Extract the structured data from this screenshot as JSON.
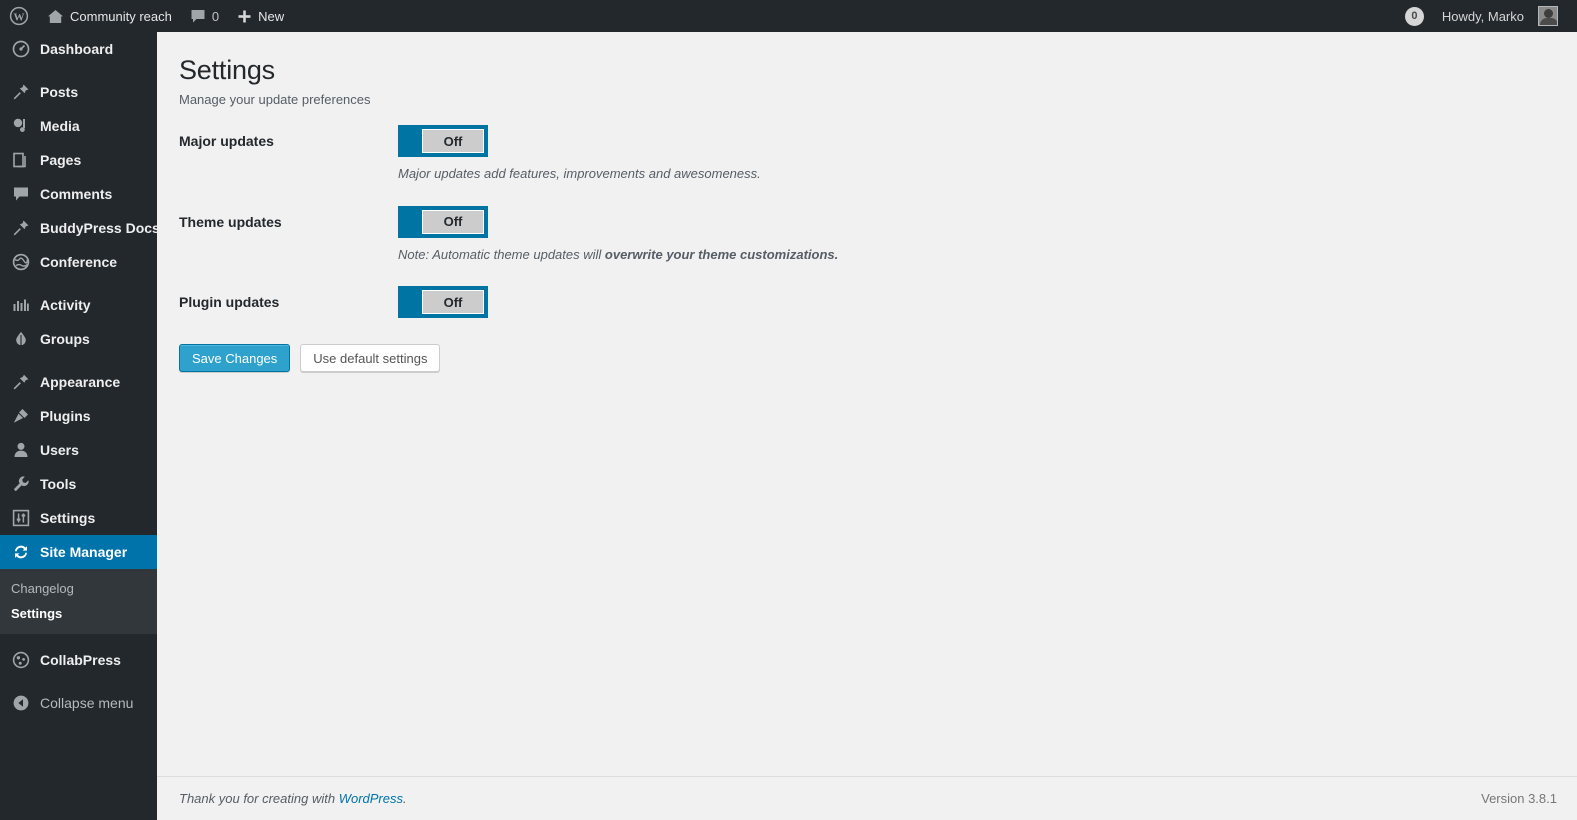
{
  "adminbar": {
    "wp_logo_icon": "wordpress-logo-icon",
    "site_name": "Community reach",
    "site_icon": "home-icon",
    "comments_icon": "comment-bubble-icon",
    "comments_count": "0",
    "new_icon": "plus-icon",
    "new_label": "New",
    "updates_count": "0",
    "howdy": "Howdy, Marko",
    "avatar": "user-avatar"
  },
  "sidebar": {
    "items": [
      {
        "label": "Dashboard",
        "icon": "dashboard-icon",
        "sep_before": false
      },
      {
        "label": "Posts",
        "icon": "pin-icon",
        "sep_before": true
      },
      {
        "label": "Media",
        "icon": "media-icon",
        "sep_before": false
      },
      {
        "label": "Pages",
        "icon": "pages-icon",
        "sep_before": false
      },
      {
        "label": "Comments",
        "icon": "comment-bubble-icon",
        "sep_before": false
      },
      {
        "label": "BuddyPress Docs",
        "icon": "pin-icon",
        "sep_before": false
      },
      {
        "label": "Conference",
        "icon": "globe-icon",
        "sep_before": false
      },
      {
        "label": "Activity",
        "icon": "activity-icon",
        "sep_before": true
      },
      {
        "label": "Groups",
        "icon": "groups-icon",
        "sep_before": false
      },
      {
        "label": "Appearance",
        "icon": "brush-icon",
        "sep_before": true
      },
      {
        "label": "Plugins",
        "icon": "plug-icon",
        "sep_before": false
      },
      {
        "label": "Users",
        "icon": "user-icon",
        "sep_before": false
      },
      {
        "label": "Tools",
        "icon": "wrench-icon",
        "sep_before": false
      },
      {
        "label": "Settings",
        "icon": "sliders-icon",
        "sep_before": false
      }
    ],
    "current": {
      "label": "Site Manager",
      "icon": "sync-icon"
    },
    "submenu": [
      {
        "label": "Changelog",
        "current": false
      },
      {
        "label": "Settings",
        "current": true
      }
    ],
    "after": [
      {
        "label": "CollabPress",
        "icon": "collabpress-icon",
        "sep_before": true
      }
    ],
    "collapse": {
      "label": "Collapse menu",
      "icon": "collapse-arrow-icon"
    }
  },
  "main": {
    "title": "Settings",
    "subtitle": "Manage your update preferences",
    "settings": [
      {
        "label": "Major updates",
        "toggle_value": "Off",
        "help_prefix": "Major updates add features, improvements and awesomeness.",
        "help_bold": ""
      },
      {
        "label": "Theme updates",
        "toggle_value": "Off",
        "help_prefix": "Note: Automatic theme updates will ",
        "help_bold": "overwrite your theme customizations."
      },
      {
        "label": "Plugin updates",
        "toggle_value": "Off",
        "help_prefix": "",
        "help_bold": ""
      }
    ],
    "buttons": {
      "primary": "Save Changes",
      "secondary": "Use default settings"
    }
  },
  "footer": {
    "thanks_prefix": "Thank you for creating with ",
    "link": "WordPress",
    "thanks_suffix": ".",
    "version": "Version 3.8.1"
  },
  "colors": {
    "admin_bar": "#23282d",
    "sidebar": "#23282d",
    "submenu": "#32373c",
    "accent_current": "#0073aa",
    "toggle_blue": "#0074a2",
    "primary_button": "#2ea2cc",
    "content_bg": "#f1f1f1",
    "link": "#0073aa"
  }
}
